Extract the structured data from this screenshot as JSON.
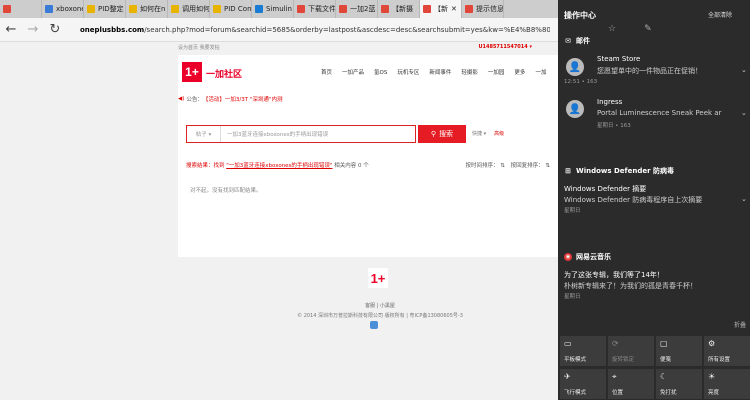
{
  "browser": {
    "tabs": [
      {
        "label": "",
        "color": "#e0473a",
        "icon": "page-icon"
      },
      {
        "label": "xboxone",
        "color": "#3a7bd5",
        "icon": "page-icon"
      },
      {
        "label": "PID整定",
        "color": "#e8b400",
        "icon": "pdf-icon"
      },
      {
        "label": "如何在n",
        "color": "#e8b400",
        "icon": "pdf-icon"
      },
      {
        "label": "调用如何",
        "color": "#e8b400",
        "icon": "pdf-icon"
      },
      {
        "label": "PID Con",
        "color": "#e8b400",
        "icon": "pdf-icon"
      },
      {
        "label": "Simulin",
        "color": "#1a7bd4",
        "icon": "page-icon"
      },
      {
        "label": "下载文件",
        "color": "#e0473a",
        "icon": "page-icon"
      },
      {
        "label": "一加2蓝",
        "color": "#e0473a",
        "icon": "page-icon"
      },
      {
        "label": "【新摄",
        "color": "#e0473a",
        "icon": "page-icon"
      },
      {
        "label": "【新",
        "color": "#e0473a",
        "icon": "page-icon"
      },
      {
        "label": "提示信息",
        "color": "#e0473a",
        "icon": "page-icon"
      }
    ],
    "url_domain": "oneplusbbs.com",
    "url_rest": "/search.php?mod=forum&searchid=5685&orderby=lastpost&ascdesc=desc&searchsubmit=yes&kw=%E4%B8%80%E5%8A%A03%E8%93%9D"
  },
  "page": {
    "top_left": "设为首页   我要发帖",
    "top_right": "U1485711547014 ▾",
    "logo_char": "1+",
    "logo_text": "一加社区",
    "nav": [
      "首页",
      "一加产品",
      "氢OS",
      "玩机专区",
      "新闻事件",
      "轻摄影",
      "一加园",
      "更多",
      "一加"
    ],
    "notice_label": "公告：",
    "notice_tag": "【活动】",
    "notice_text": "一加3/3T \"深圳通\"内测",
    "search_type": "帖子 ▾",
    "search_placeholder": "一加3蓝牙连接xboxones的手柄出现错误",
    "search_button": "搜索",
    "search_links": [
      "快捷 ▾",
      "高级"
    ],
    "results_prefix": "搜索结果：找到",
    "results_query": "\"一加3蓝牙连接xboxones的手柄出现错误\"",
    "results_suffix": "相关内容 0 个",
    "sort_time": "按时间排序：",
    "sort_reply": "按回复排序：",
    "no_results": "对不起，没有找到匹配结果。",
    "footer_logo": "1+",
    "footer_links": "客服 | 小黑屋",
    "footer_copy": "© 2014 深圳市万普拉斯科技有限公司 版权所有 | 粤ICP备13080605号-3"
  },
  "action_center": {
    "title": "操作中心",
    "clear_all": "全部清除",
    "mail_section": "邮件",
    "mail": [
      {
        "title": "Steam Store",
        "body": "您愿望单中的一件物品正在促销！",
        "meta": "12:51 • 163"
      },
      {
        "title": "Ingress",
        "body": "Portal Luminescence Sneak Peek ar",
        "meta": "星期日 • 163"
      }
    ],
    "defender_section": "Windows Defender 防病毒",
    "defender": {
      "title": "Windows Defender 摘要",
      "body": "Windows Defender 防病毒程序自上次摘要",
      "meta": "星期日"
    },
    "music_section": "网易云音乐",
    "music": {
      "title": "为了这张专辑，我们等了14年！",
      "body": "朴树新专辑来了！为我们的孤是青春千杯！",
      "meta": "星期日"
    },
    "collapse": "折叠",
    "quick_actions": [
      {
        "label": "平板模式",
        "icon": "tablet-icon",
        "dim": false
      },
      {
        "label": "旋转锁定",
        "icon": "rotation-lock-icon",
        "dim": true
      },
      {
        "label": "便笺",
        "icon": "note-icon",
        "dim": false
      },
      {
        "label": "所有设置",
        "icon": "gear-icon",
        "dim": false
      },
      {
        "label": "飞行模式",
        "icon": "airplane-icon",
        "dim": false
      },
      {
        "label": "位置",
        "icon": "location-icon",
        "dim": false
      },
      {
        "label": "免打扰",
        "icon": "moon-icon",
        "dim": false
      },
      {
        "label": "亮度",
        "icon": "brightness-icon",
        "dim": false
      }
    ]
  }
}
